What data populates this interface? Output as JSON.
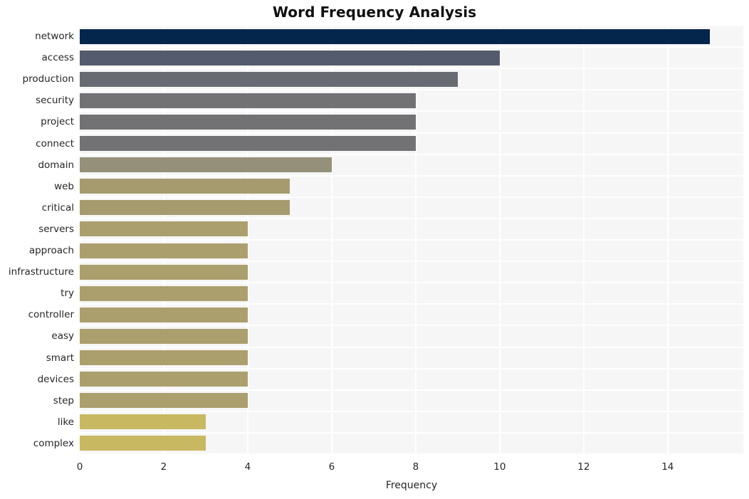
{
  "chart_data": {
    "type": "bar",
    "orientation": "horizontal",
    "title": "Word Frequency Analysis",
    "xlabel": "Frequency",
    "ylabel": "",
    "categories": [
      "network",
      "access",
      "production",
      "security",
      "project",
      "connect",
      "domain",
      "web",
      "critical",
      "servers",
      "approach",
      "infrastructure",
      "try",
      "controller",
      "easy",
      "smart",
      "devices",
      "step",
      "like",
      "complex"
    ],
    "values": [
      15,
      10,
      9,
      8,
      8,
      8,
      6,
      5,
      5,
      4,
      4,
      4,
      4,
      4,
      4,
      4,
      4,
      4,
      3,
      3
    ],
    "bar_colors": [
      "#04254c",
      "#555b6e",
      "#686b72",
      "#727274",
      "#727274",
      "#727274",
      "#95907a",
      "#a59b6f",
      "#a59b6f",
      "#ab9f6d",
      "#ab9f6d",
      "#ab9f6d",
      "#ab9f6d",
      "#ab9f6d",
      "#ab9f6d",
      "#ab9f6d",
      "#ab9f6d",
      "#ab9f6d",
      "#c8b862",
      "#c8b862"
    ],
    "xlim": [
      0,
      15.8
    ],
    "x_ticks": [
      0,
      2,
      4,
      6,
      8,
      10,
      12,
      14
    ],
    "x_tick_labels": [
      "0",
      "2",
      "4",
      "6",
      "8",
      "10",
      "12",
      "14"
    ],
    "grid": true,
    "grid_color": "#ffffff",
    "plot_background": "#f6f6f6",
    "figure_background": "#ffffff",
    "legend": null,
    "legend_position": "none"
  }
}
